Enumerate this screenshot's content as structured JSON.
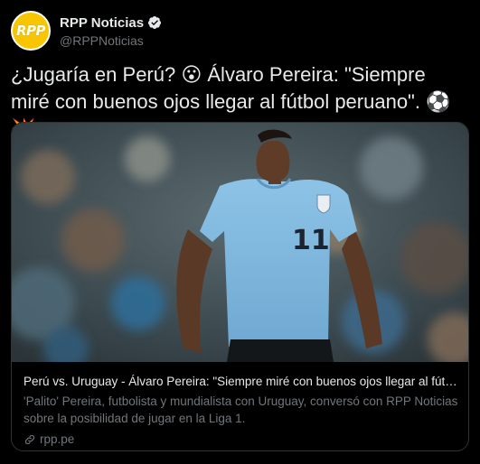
{
  "account": {
    "avatar_text": "RPP",
    "display_name": "RPP Noticias",
    "handle": "@RPPNoticias",
    "avatar_color": "#f7c600",
    "verified_color": "#e7e9ea"
  },
  "tweet": {
    "text": "¿Jugaría en Perú? 😮 Álvaro Pereira: \"Siempre miré con buenos ojos llegar al fútbol peruano\". ⚽💥"
  },
  "card": {
    "image_icon": "player-photo-image",
    "title": "Perú vs. Uruguay - Álvaro Pereira: \"Siempre miré con buenos ojos llegar al fútbo...",
    "description": "'Palito' Pereira, futbolista y mundialista con Uruguay, conversó con RPP Noticias sobre la posibilidad de jugar en la Liga 1.",
    "domain": "rpp.pe",
    "jersey_number": "11"
  }
}
